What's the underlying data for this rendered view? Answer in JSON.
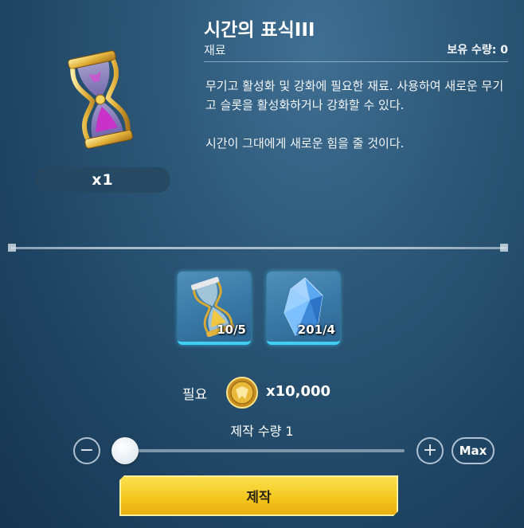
{
  "item": {
    "name": "시간의 표식III",
    "category": "재료",
    "owned_label": "보유 수량: 0",
    "quantity_label": "x1",
    "icon": "hourglass-icon",
    "description": [
      "무기고 활성화 및 강화에 필요한 재료. 사용하여 새로운 무기고 슬롯을 활성화하거나 강화할 수 있다.",
      "시간이 그대에게 새로운 힘을 줄 것이다."
    ]
  },
  "materials": [
    {
      "icon": "hourglass-icon",
      "count": "10/5"
    },
    {
      "icon": "crystal-icon",
      "count": "201/4"
    }
  ],
  "requirement": {
    "label": "필요",
    "icon": "gold-coin-icon",
    "amount": "x10,000"
  },
  "craft": {
    "quantity_label": "제작 수량 1",
    "quantity": 1,
    "minus_symbol": "−",
    "plus_symbol": "+",
    "max_label": "Max",
    "button_label": "제작"
  },
  "colors": {
    "accent_yellow": "#f4c51c",
    "slot_glow": "#3fcff5",
    "background": "#2d5878"
  }
}
